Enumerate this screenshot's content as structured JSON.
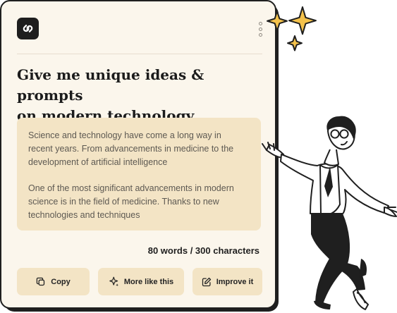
{
  "header": {
    "logo_icon": "link-logo-icon",
    "menu_icon": "kebab-menu-icon"
  },
  "prompt": {
    "title": "Give me unique ideas & prompts\non modern technology"
  },
  "response": {
    "paragraph_1": "Science and technology have come a long way in\nrecent years. From advancements in medicine to the\ndevelopment of artificial intelligence",
    "paragraph_2": "One of the most significant advancements in modern\nscience is in the field of medicine. Thanks to new\ntechnologies and techniques"
  },
  "stats": {
    "count_label": "80 words / 300 characters"
  },
  "actions": {
    "copy_label": "Copy",
    "copy_icon": "copy-icon",
    "more_label": "More like this",
    "more_icon": "sparkle-icon",
    "improve_label": "Improve it",
    "improve_icon": "edit-icon"
  },
  "colors": {
    "card_background": "#fbf6ec",
    "panel_background": "#f3e4c5",
    "outline": "#1f1f1f",
    "sparkle": "#f4c24b"
  }
}
